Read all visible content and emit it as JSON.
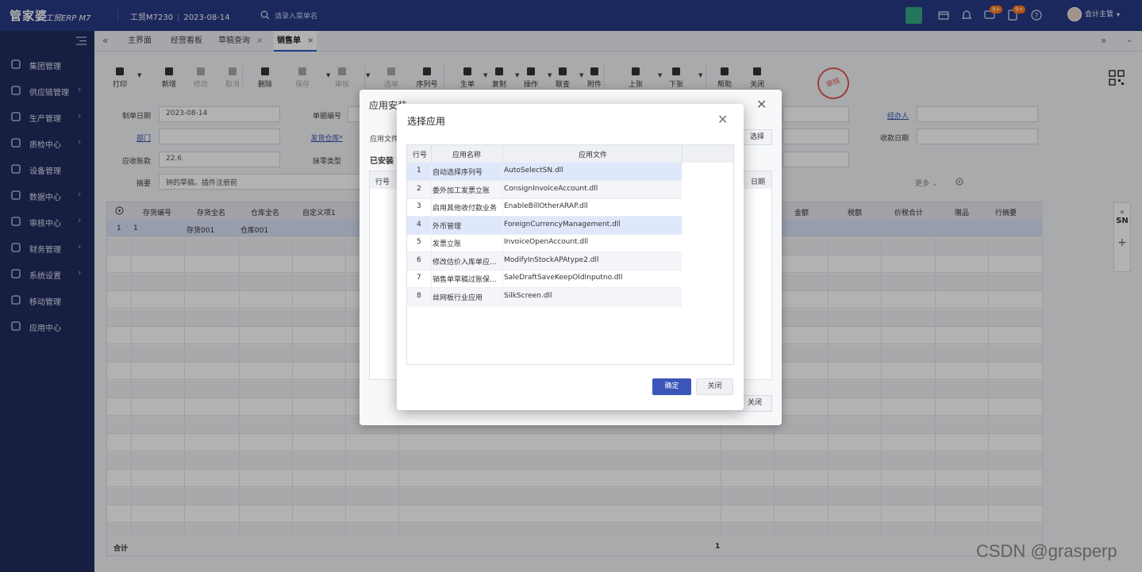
{
  "topbar": {
    "brand": "管家婆",
    "brand_sub": "工贸ERP M7",
    "product": "工贸M7230",
    "date": "2023-08-14",
    "search_placeholder": "请录入菜单名",
    "user": "会计主管",
    "badge_msg": "9+",
    "badge_task": "9+"
  },
  "sidebar": {
    "items": [
      {
        "label": "集团管理",
        "icon": "layers-icon",
        "arrow": false
      },
      {
        "label": "供应链管理",
        "icon": "supply-chain-icon",
        "arrow": true
      },
      {
        "label": "生产管理",
        "icon": "production-icon",
        "arrow": true
      },
      {
        "label": "质检中心",
        "icon": "inspection-icon",
        "arrow": true
      },
      {
        "label": "设备管理",
        "icon": "equipment-icon",
        "arrow": false
      },
      {
        "label": "数据中心",
        "icon": "chart-icon",
        "arrow": true
      },
      {
        "label": "审核中心",
        "icon": "user-icon",
        "arrow": true
      },
      {
        "label": "财务管理",
        "icon": "money-icon",
        "arrow": true
      },
      {
        "label": "系统设置",
        "icon": "gear-icon",
        "arrow": true
      },
      {
        "label": "移动管理",
        "icon": "mobile-icon",
        "arrow": false
      },
      {
        "label": "应用中心",
        "icon": "app-icon",
        "arrow": false
      }
    ]
  },
  "tabs": [
    {
      "label": "主界面",
      "closable": false,
      "active": false
    },
    {
      "label": "经营看板",
      "closable": false,
      "active": false
    },
    {
      "label": "草稿查询",
      "closable": true,
      "active": false
    },
    {
      "label": "销售单",
      "closable": true,
      "active": true
    }
  ],
  "toolbar": {
    "buttons": [
      "打印",
      "新增",
      "修改",
      "取消",
      "删除",
      "保存",
      "审核",
      "选单",
      "序列号",
      "生单",
      "复制",
      "操作",
      "联查",
      "附件",
      "上张",
      "下张",
      "帮助",
      "关闭"
    ],
    "stamp": "审核"
  },
  "form": {
    "date_label": "制单日期",
    "date_value": "2023-08-14",
    "billno_label": "单据编号",
    "dept_label": "部门",
    "warehouse_label": "发货仓库*",
    "ar_label": "应收账款",
    "ar_value": "22.6",
    "round_label": "抹零类型",
    "memo_label": "摘要",
    "memo_value": "钟的草稿，插件注册前",
    "handler_label": "经办人",
    "recv_date_label": "收款日期",
    "more": "更多"
  },
  "grid": {
    "headers": [
      "存货编号",
      "存货全名",
      "仓库全名",
      "自定义项1",
      "金额",
      "税额",
      "价税合计",
      "赠品",
      "行摘要"
    ],
    "row1": {
      "no": "1",
      "code": "1",
      "name": "存货001",
      "wh": "仓库001"
    },
    "sum_label": "合计",
    "sum_value": "1"
  },
  "right_panel": {
    "label": "SN",
    "plus": "+"
  },
  "dialog_install": {
    "title": "应用安装",
    "file_label": "应用文件",
    "installed_label": "已安装",
    "col_rowno": "行号",
    "col_date": "日期",
    "select_btn": "选择",
    "close_btn": "关闭"
  },
  "dialog_select": {
    "title": "选择应用",
    "columns": [
      "行号",
      "应用名称",
      "应用文件"
    ],
    "rows": [
      {
        "no": "1",
        "name": "自动选择序列号",
        "file": "AutoSelectSN.dll"
      },
      {
        "no": "2",
        "name": "委外加工发票立账",
        "file": "ConsignInvoiceAccount.dll"
      },
      {
        "no": "3",
        "name": "启用其他收付款业务",
        "file": "EnableBillOtherARAP.dll"
      },
      {
        "no": "4",
        "name": "外币管理",
        "file": "ForeignCurrencyManagement.dll"
      },
      {
        "no": "5",
        "name": "发票立账",
        "file": "InvoiceOpenAccount.dll"
      },
      {
        "no": "6",
        "name": "修改估价入库单应...",
        "file": "ModifyInStockAPAtype2.dll"
      },
      {
        "no": "7",
        "name": "销售单草稿过账保...",
        "file": "SaleDraftSaveKeepOldInputno.dll"
      },
      {
        "no": "8",
        "name": "丝网板行业应用",
        "file": "SilkScreen.dll"
      }
    ],
    "ok": "确定",
    "close": "关闭"
  },
  "watermark": "CSDN @grasperp"
}
